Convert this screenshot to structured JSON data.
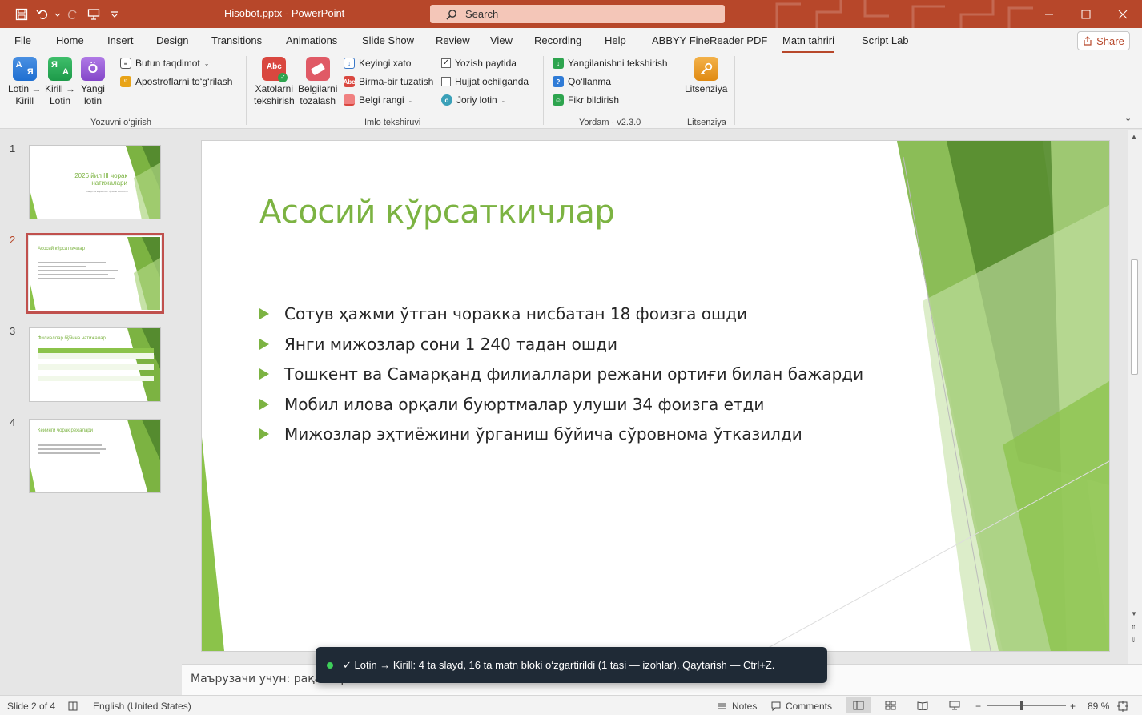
{
  "app": {
    "doc_title": "Hisobot.pptx  -  PowerPoint",
    "search_placeholder": "Search",
    "share_label": "Share"
  },
  "tabs": [
    "File",
    "Home",
    "Insert",
    "Design",
    "Transitions",
    "Animations",
    "Slide Show",
    "Review",
    "View",
    "Recording",
    "Help",
    "ABBYY FineReader PDF",
    "Matn tahriri",
    "Script Lab"
  ],
  "active_tab": "Matn tahriri",
  "ribbon": {
    "group1": {
      "label": "Yozuvni o‘girish",
      "btn_lat2cyr": "Lotin →\nKirill",
      "btn_lat2cyr_l1": "Lotin →",
      "btn_lat2cyr_l2": "Kirill",
      "btn_cyr2lat_l1": "Kirill →",
      "btn_cyr2lat_l2": "Lotin",
      "btn_new_l1": "Yangi",
      "btn_new_l2": "lotin",
      "icon_lat2cyr": "А\nЯ",
      "icon_cyr2lat": "Я\nА",
      "icon_new": "Ö",
      "butun": "Butun taqdimot",
      "apostrof": "Apostroflarni to‘g‘rilash"
    },
    "group2": {
      "label": "Imlo tekshiruvi",
      "btn_check_l1": "Xatolarni",
      "btn_check_l2": "tekshirish",
      "btn_clear_l1": "Belgilarni",
      "btn_clear_l2": "tozalash",
      "next_error": "Keyingi xato",
      "fix_one": "Birma-bir tuzatish",
      "mark_color": "Belgi rangi",
      "while_typing": "Yozish paytida",
      "on_open": "Hujjat ochilganda",
      "current_lotin": "Joriy lotin",
      "while_typing_checked": "✓"
    },
    "group3": {
      "label": "Yordam · v2.3.0",
      "updates": "Yangilanishni tekshirish",
      "manual": "Qo‘llanma",
      "feedback": "Fikr bildirish"
    },
    "group4": {
      "label": "Litsenziya",
      "btn": "Litsenziya"
    }
  },
  "thumbnails": [
    {
      "num": "1",
      "title": "2026 йил III чорак натижалари",
      "sub": "Савдо ва маркетинг бўлими хисоботи"
    },
    {
      "num": "2",
      "title": "Асосий кўрсаткичлар"
    },
    {
      "num": "3",
      "title": "Филиаллар бўйича натижалар"
    },
    {
      "num": "4",
      "title": "Кейинги чорак режалари"
    }
  ],
  "slide": {
    "title": "Асосий кўрсаткичлар",
    "bullets": [
      "Сотув ҳажми ўтган чоракка нисбатан 18 фоизга ошди",
      "Янги мижозлар сони 1 240 тадан ошди",
      "Тошкент ва Самарқанд филиаллари режани ортиғи билан бажарди",
      "Мобил илова орқали буюртмалар улуши 34 фоизга етди",
      "Мижозлар эҳтиёжини ўрганиш бўйича сўровнома ўтказилди"
    ]
  },
  "notes": {
    "text": "Маърузачи учун: рақам                                                                                                                                                                        иринг."
  },
  "toast": {
    "message": "✓ Lotin → Kirill: 4 ta slayd, 16 ta matn bloki o‘zgartirildi (1 tasi — izohlar). Qaytarish — Ctrl+Z."
  },
  "status": {
    "slide_of": "Slide 2 of 4",
    "language": "English (United States)",
    "notes": "Notes",
    "comments": "Comments",
    "zoom": "89 %",
    "minus": "−",
    "plus": "+"
  },
  "colors": {
    "accent": "#b7472a",
    "slide_green": "#7cb342"
  }
}
